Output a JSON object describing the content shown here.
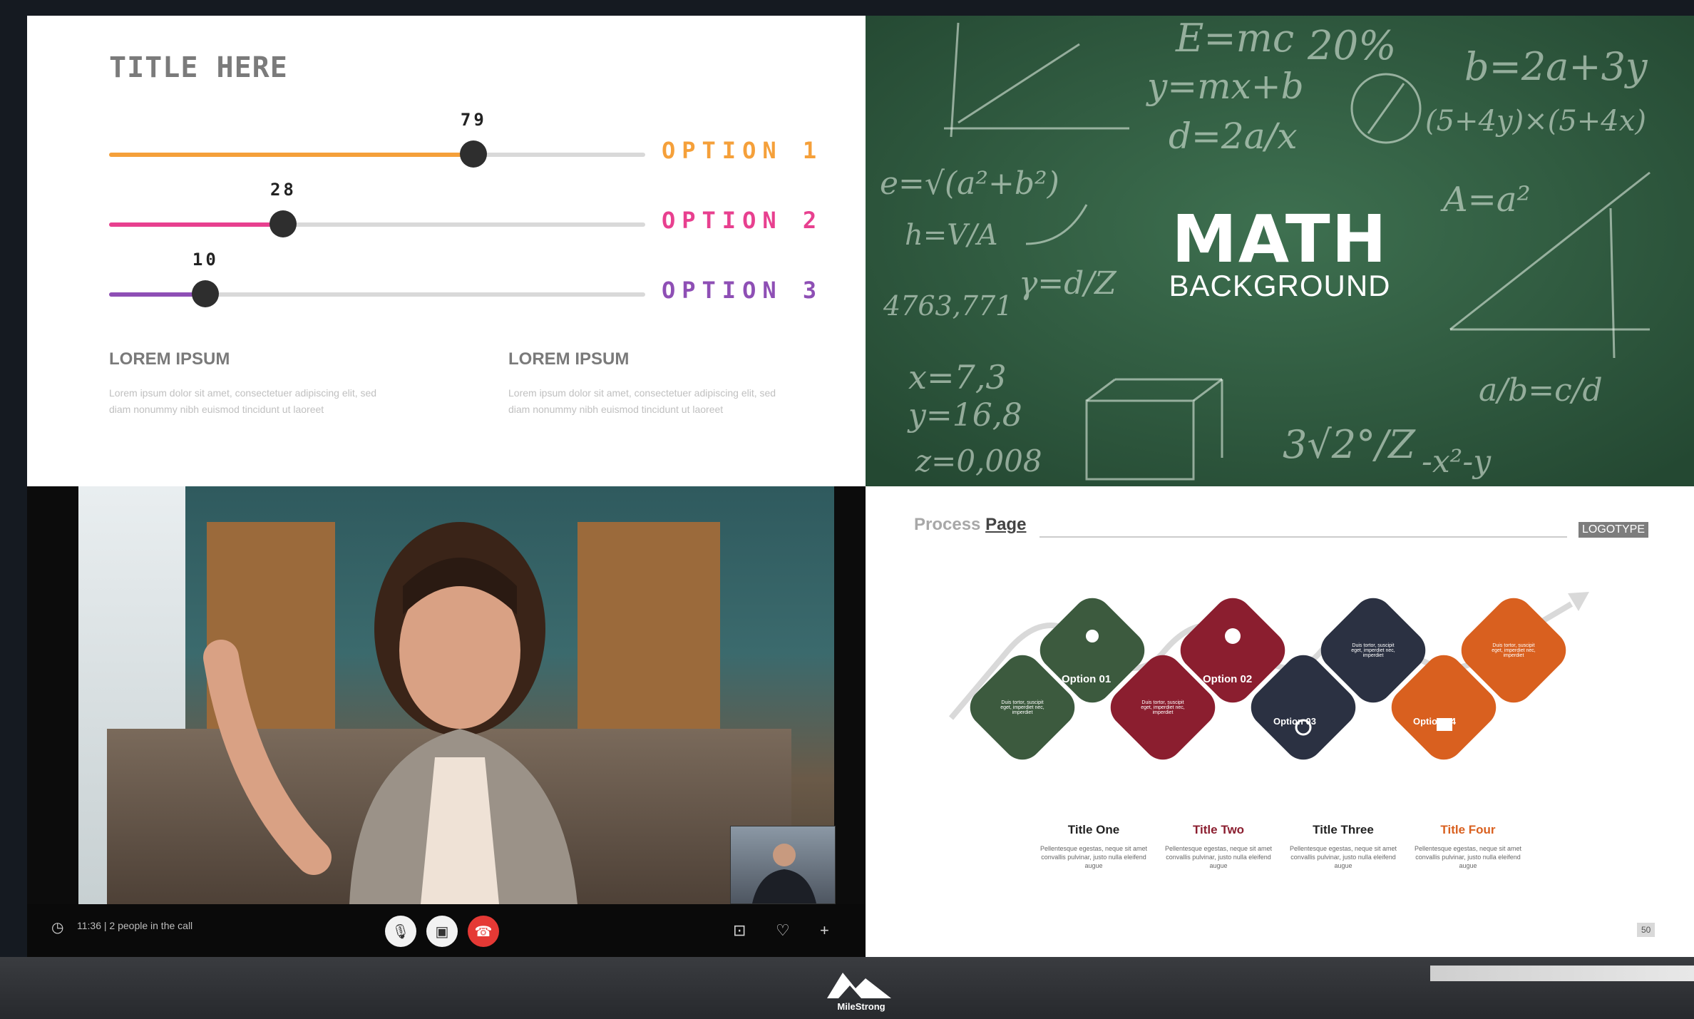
{
  "slider_slide": {
    "title": "TITLE HERE",
    "sliders": [
      {
        "value": "79",
        "level_pct": 68,
        "option": "OPTION 1",
        "color": "#f5a03a"
      },
      {
        "value": "28",
        "level_pct": 32.5,
        "option": "OPTION 2",
        "color": "#e8408f"
      },
      {
        "value": "10",
        "level_pct": 18,
        "option": "OPTION 3",
        "color": "#8e4fb5"
      }
    ],
    "columns": [
      {
        "heading": "LOREM IPSUM",
        "text": "Lorem ipsum dolor sit amet, consectetuer adipiscing elit, sed diam nonummy nibh euismod tincidunt ut laoreet"
      },
      {
        "heading": "LOREM IPSUM",
        "text": "Lorem ipsum dolor sit amet, consectetuer adipiscing elit, sed diam nonummy nibh euismod tincidunt ut laoreet"
      }
    ]
  },
  "math_slide": {
    "title": "MATH",
    "subtitle": "BACKGROUND",
    "chalk": [
      "E=mc",
      "y=mx+b",
      "d=2a/x",
      "b=2a+3y",
      "(5+4y)×(5+4x)",
      "A=a²",
      "e=√(a²+b²)",
      "h=V/A",
      "γ=d/Z",
      "4763,771",
      "x=7,3",
      "y=16,8",
      "z=0,008",
      "3√2°/Z",
      "a/b=c/d",
      "-x²-y",
      "20%"
    ]
  },
  "video_call": {
    "status": "11:36 | 2 people in the call",
    "icons": [
      "mic-icon",
      "camera-icon",
      "end-call-icon",
      "screen-share-icon",
      "heart-icon",
      "plus-icon"
    ],
    "end_call_color": "#e53935"
  },
  "process_slide": {
    "header_light": "Process",
    "header_bold": "Page",
    "logotype": "LOGOTYPE",
    "options": [
      {
        "label": "Option 01",
        "color": "#3c5a3e"
      },
      {
        "label": "Option 02",
        "color": "#8b1e2f"
      },
      {
        "label": "Option 03",
        "color": "#2b3142"
      },
      {
        "label": "Option 04",
        "color": "#d9601f"
      }
    ],
    "small_diamond_text": "Duis tortor, suscipit eget, imperdiet nec, imperdiet",
    "columns": [
      {
        "title": "Title One",
        "color": "#222222",
        "text": "Pellentesque egestas, neque sit amet convallis pulvinar, justo nulla eleifend augue"
      },
      {
        "title": "Title Two",
        "color": "#8b1e2f",
        "text": "Pellentesque egestas, neque sit amet convallis pulvinar, justo nulla eleifend augue"
      },
      {
        "title": "Title Three",
        "color": "#222222",
        "text": "Pellentesque egestas, neque sit amet convallis pulvinar, justo nulla eleifend augue"
      },
      {
        "title": "Title Four",
        "color": "#d9601f",
        "text": "Pellentesque egestas, neque sit amet convallis pulvinar, justo nulla eleifend augue"
      }
    ],
    "page_number": "50"
  },
  "brand": {
    "name": "MileStrong"
  }
}
